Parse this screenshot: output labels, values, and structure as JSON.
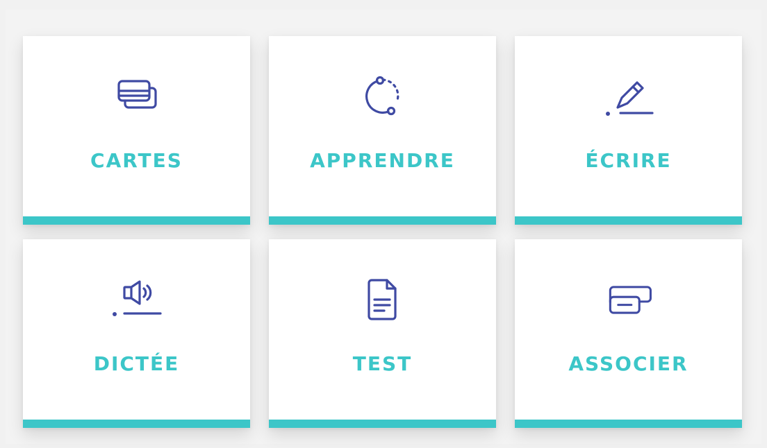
{
  "colors": {
    "accent": "#3cc6c8",
    "icon": "#3f4aa3",
    "card_background": "#ffffff",
    "page_background": "#f1f1f1"
  },
  "modes": [
    {
      "id": "cartes",
      "label": "CARTES",
      "icon": "cards-icon"
    },
    {
      "id": "apprendre",
      "label": "APPRENDRE",
      "icon": "learn-cycle-icon"
    },
    {
      "id": "ecrire",
      "label": "ÉCRIRE",
      "icon": "pen-write-icon"
    },
    {
      "id": "dictee",
      "label": "DICTÉE",
      "icon": "speaker-icon"
    },
    {
      "id": "test",
      "label": "TEST",
      "icon": "document-icon"
    },
    {
      "id": "associer",
      "label": "ASSOCIER",
      "icon": "match-icon"
    }
  ]
}
